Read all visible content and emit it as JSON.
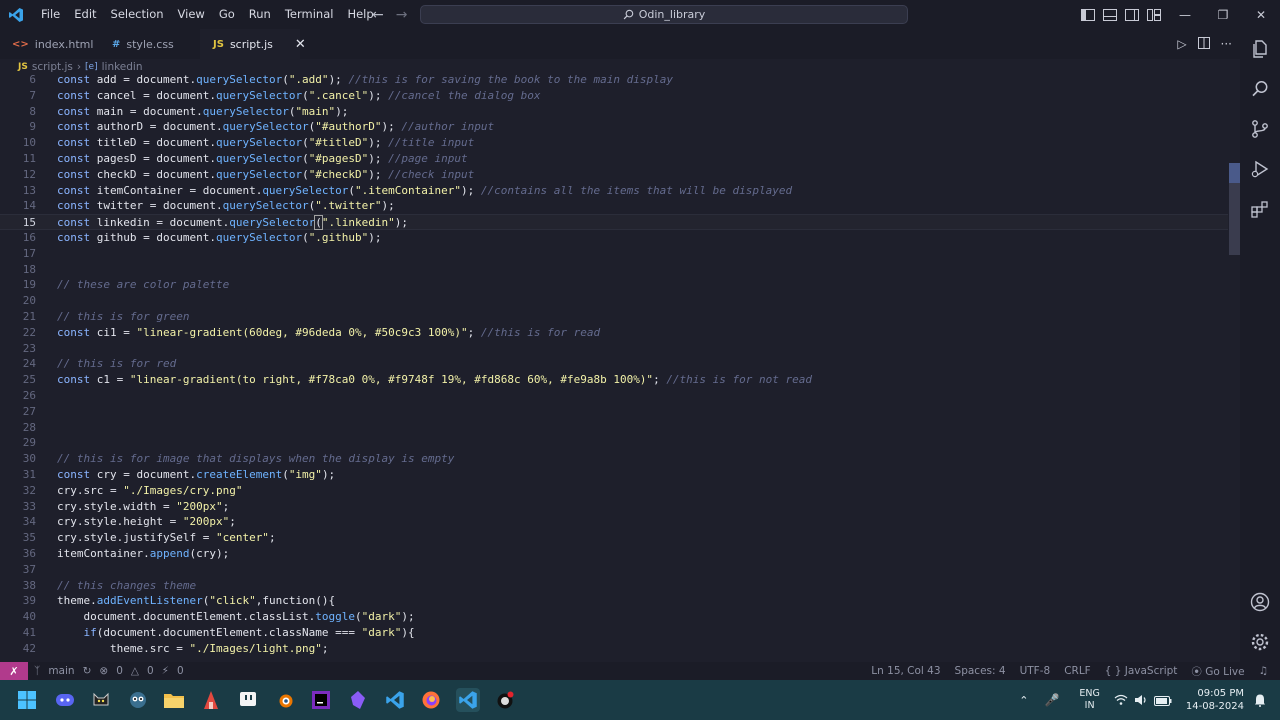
{
  "titlebar": {
    "menu": [
      "File",
      "Edit",
      "Selection",
      "View",
      "Go",
      "Run",
      "Terminal",
      "Help"
    ],
    "search_text": "Odin_library"
  },
  "tabs": [
    {
      "label": "index.html",
      "icon": "<>",
      "icon_color": "#e06c4a"
    },
    {
      "label": "style.css",
      "icon": "#",
      "icon_color": "#5aa7e8"
    },
    {
      "label": "script.js",
      "icon": "JS",
      "icon_color": "#e2c541",
      "active": true
    }
  ],
  "breadcrumb": {
    "file": "script.js",
    "symbol": "linkedin",
    "file_icon": "JS",
    "symbol_icon": "[e]"
  },
  "editor": {
    "lines": [
      {
        "n": "",
        "code": ""
      },
      {
        "n": "7",
        "code": ""
      },
      {
        "n": "8",
        "code": ""
      },
      {
        "n": "9",
        "code": ""
      }
    ],
    "l6": {
      "n": "6",
      "a": "const add = document.",
      "f": "querySelector",
      "b": "(",
      "s": "\".add\"",
      "c": "); ",
      "cm": "//this is for saving the book to the main display"
    },
    "l7": {
      "n": "7",
      "a": "const cancel = document.",
      "f": "querySelector",
      "b": "(",
      "s": "\".cancel\"",
      "c": "); ",
      "cm": "//cancel the dialog box"
    },
    "l8": {
      "n": "8",
      "a": "const main = document.",
      "f": "querySelector",
      "b": "(",
      "s": "\"main\"",
      "c": ");",
      "cm": ""
    },
    "l9": {
      "n": "9",
      "a": "const authorD = document.",
      "f": "querySelector",
      "b": "(",
      "s": "\"#authorD\"",
      "c": "); ",
      "cm": "//author input"
    },
    "l10": {
      "n": "10",
      "a": "const titleD = document.",
      "f": "querySelector",
      "b": "(",
      "s": "\"#titleD\"",
      "c": "); ",
      "cm": "//title input"
    },
    "l11": {
      "n": "11",
      "a": "const pagesD = document.",
      "f": "querySelector",
      "b": "(",
      "s": "\"#pagesD\"",
      "c": "); ",
      "cm": "//page input"
    },
    "l12": {
      "n": "12",
      "a": "const checkD = document.",
      "f": "querySelector",
      "b": "(",
      "s": "\"#checkD\"",
      "c": "); ",
      "cm": "//check input"
    },
    "l13": {
      "n": "13",
      "a": "const itemContainer = document.",
      "f": "querySelector",
      "b": "(",
      "s": "\".itemContainer\"",
      "c": "); ",
      "cm": "//contains all the items that will be displayed"
    },
    "l14": {
      "n": "14",
      "a": "const twitter = document.",
      "f": "querySelector",
      "b": "(",
      "s": "\".twitter\"",
      "c": ");",
      "cm": ""
    },
    "l15": {
      "n": "15",
      "a": "const linkedin = document.",
      "f": "querySelector",
      "b": "(",
      "s": "\".linkedin\"",
      "c": ");",
      "cm": ""
    },
    "l16": {
      "n": "16",
      "a": "const github = document.",
      "f": "querySelector",
      "b": "(",
      "s": "\".github\"",
      "c": ");",
      "cm": ""
    },
    "l17": {
      "n": "17"
    },
    "l18": {
      "n": "18"
    },
    "l19": {
      "n": "19",
      "cm": "// these are color palette"
    },
    "l20": {
      "n": "20"
    },
    "l21": {
      "n": "21",
      "cm": "// this is for green"
    },
    "l22": {
      "n": "22",
      "a": "const ci1 = ",
      "s": "\"linear-gradient(60deg, #96deda 0%, #50c9c3 100%)\"",
      "c": "; ",
      "cm": "//this is for read"
    },
    "l23": {
      "n": "23"
    },
    "l24": {
      "n": "24",
      "cm": "// this is for red"
    },
    "l25": {
      "n": "25",
      "a": "const c1 = ",
      "s": "\"linear-gradient(to right, #f78ca0 0%, #f9748f 19%, #fd868c 60%, #fe9a8b 100%)\"",
      "c": "; ",
      "cm": "//this is for not read"
    },
    "l26": {
      "n": "26"
    },
    "l27": {
      "n": "27"
    },
    "l28": {
      "n": "28"
    },
    "l29": {
      "n": "29"
    },
    "l30": {
      "n": "30",
      "cm": "// this is for image that displays when the display is empty"
    },
    "l31": {
      "n": "31",
      "a": "const cry = document.",
      "f": "createElement",
      "b": "(",
      "s": "\"img\"",
      "c": ");"
    },
    "l32": {
      "n": "32",
      "a": "cry.src = ",
      "s": "\"./Images/cry.png\""
    },
    "l33": {
      "n": "33",
      "a": "cry.style.width = ",
      "s": "\"200px\"",
      "c": ";"
    },
    "l34": {
      "n": "34",
      "a": "cry.style.height = ",
      "s": "\"200px\"",
      "c": ";"
    },
    "l35": {
      "n": "35",
      "a": "cry.style.justifySelf = ",
      "s": "\"center\"",
      "c": ";"
    },
    "l36": {
      "n": "36",
      "a": "itemContainer.",
      "f": "append",
      "b": "(",
      "c": "cry);"
    },
    "l37": {
      "n": "37"
    },
    "l38": {
      "n": "38",
      "cm": "// this changes theme"
    },
    "l39": {
      "n": "39",
      "a": "theme.",
      "f": "addEventListener",
      "b": "(",
      "s": "\"click\"",
      "c": ",function(){"
    },
    "l40": {
      "n": "40",
      "a": "    document.documentElement.classList.",
      "f": "toggle",
      "b": "(",
      "s": "\"dark\"",
      "c": ");"
    },
    "l41": {
      "n": "41",
      "a": "    if(document.documentElement.className === ",
      "s": "\"dark\"",
      "c": "){"
    },
    "l42": {
      "n": "42",
      "a": "        theme.src = ",
      "s": "\"./Images/light.png\"",
      "c": ";"
    }
  },
  "statusbar": {
    "branch": "main",
    "errors": "0",
    "warnings": "0",
    "ports": "0",
    "position": "Ln 15, Col 43",
    "spaces": "Spaces: 4",
    "encoding": "UTF-8",
    "eol": "CRLF",
    "language": "{ } JavaScript",
    "golive": "Go Live"
  },
  "taskbar": {
    "lang_top": "ENG",
    "lang_bottom": "IN",
    "time": "09:05 PM",
    "date": "14-08-2024"
  },
  "colors": {
    "accent": "#b13a8c",
    "taskbar": "#1a3b45"
  }
}
